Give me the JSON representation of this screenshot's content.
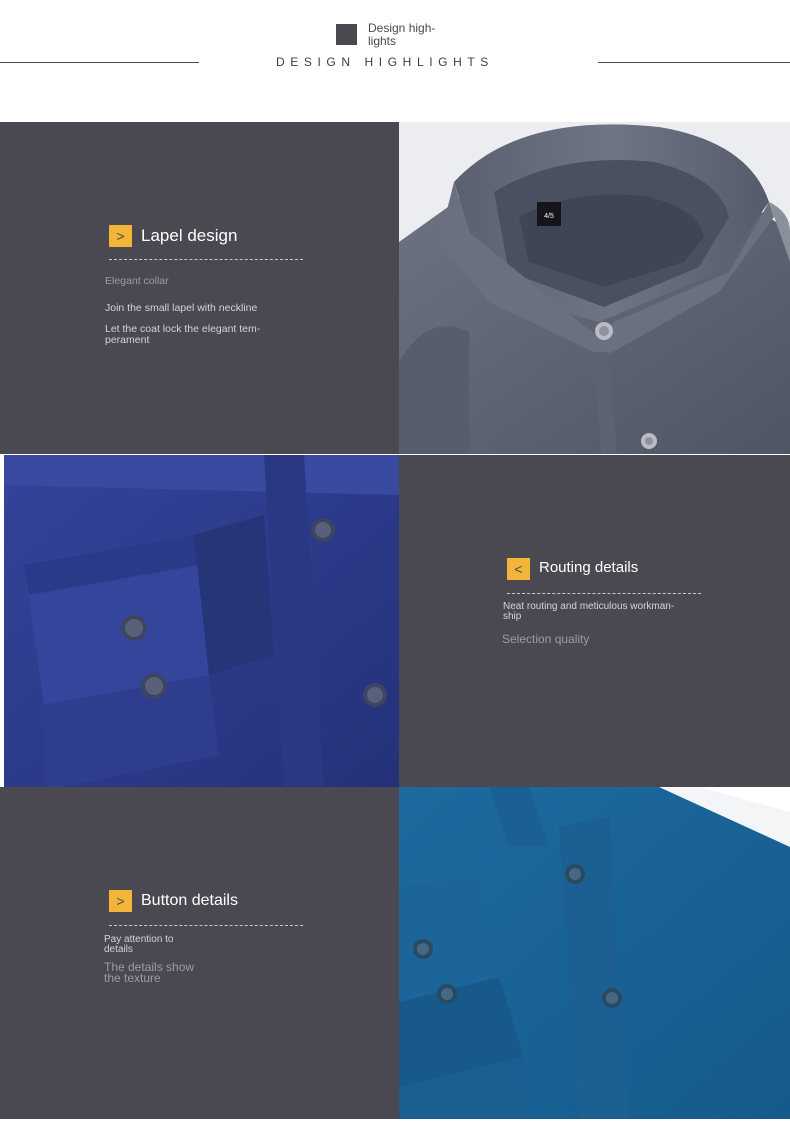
{
  "header": {
    "small_label": "Design high-lights",
    "title": "DESIGN HIGHLIGHTS"
  },
  "colors": {
    "panel_dark": "#4a4951",
    "accent": "#f3b43a",
    "shirt_grey": "#646a79",
    "shirt_navy": "#2e3d85",
    "shirt_teal": "#1e5f92"
  },
  "sections": [
    {
      "tag_icon": ">",
      "heading": "Lapel design",
      "subtitle": "Elegant collar",
      "line1": "Join the small lapel with neckline",
      "line2": "Let the coat lock the elegant tem-perament"
    },
    {
      "tag_icon": "<",
      "heading": "Routing details",
      "subtitle": "Neat routing and meticulous workman-ship",
      "line1": "Selection quality"
    },
    {
      "tag_icon": ">",
      "heading": "Button details",
      "subtitle": "Pay attention to details",
      "line1": "The details show the texture"
    }
  ],
  "images": [
    {
      "name": "grey-shirt-collar-photo",
      "label": "4/5"
    },
    {
      "name": "navy-shirt-cuff-photo"
    },
    {
      "name": "teal-shirt-buttons-photo"
    }
  ]
}
